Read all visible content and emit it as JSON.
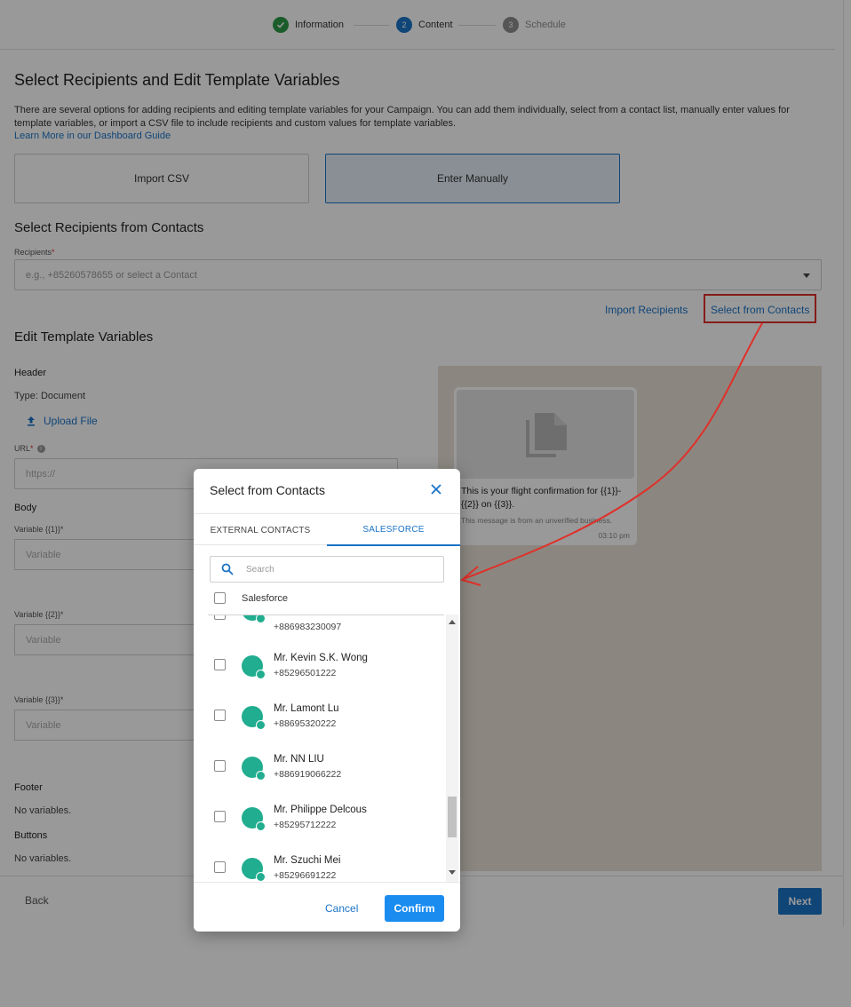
{
  "stepper": {
    "steps": [
      {
        "num": "✓",
        "label": "Information",
        "state": "done"
      },
      {
        "num": "2",
        "label": "Content",
        "state": "active"
      },
      {
        "num": "3",
        "label": "Schedule",
        "state": "todo"
      }
    ]
  },
  "page": {
    "title": "Select Recipients and Edit Template Variables",
    "intro": "There are several options for adding recipients and editing template variables for your Campaign. You can add them individually, select from a contact list, manually enter values for template variables, or import a CSV file to include recipients and custom values for template variables.",
    "intro_link": "Learn More in our Dashboard Guide",
    "option_import_csv": "Import CSV",
    "option_enter_manually": "Enter Manually",
    "recipients_section_title": "Select Recipients from Contacts",
    "recipients_label": "Recipients",
    "recipients_required": "*",
    "recipients_placeholder": "e.g., +85260578655 or select a Contact",
    "import_recipients": "Import Recipients",
    "select_from_contacts": "Select from Contacts",
    "edit_vars_title": "Edit Template Variables",
    "header_label": "Header",
    "header_type": "Type: Document",
    "upload_file": "Upload File",
    "url_label": "URL",
    "url_required": "*",
    "url_info": "i",
    "url_placeholder": "https://",
    "body_label": "Body",
    "var1_label": "Variable {{1}}*",
    "var2_label": "Variable {{2}}*",
    "var3_label": "Variable {{3}}*",
    "var_placeholder": "Variable",
    "footer_label": "Footer",
    "footer_none": "No variables.",
    "buttons_label": "Buttons",
    "buttons_none": "No variables.",
    "back": "Back",
    "next": "Next"
  },
  "preview": {
    "message": "This is your flight confirmation for {{1}}-{{2}} on {{3}}.",
    "note": "This message is from an unverified business.",
    "time": "03:10 pm"
  },
  "modal": {
    "title": "Select from Contacts",
    "tabs": [
      "EXTERNAL CONTACTS",
      "SALESFORCE"
    ],
    "active_tab": "SALESFORCE",
    "search_placeholder": "Search",
    "group_label": "Salesforce",
    "contacts": [
      {
        "name": "",
        "phone": "+886983230097"
      },
      {
        "name": "Mr. Kevin S.K. Wong",
        "phone": "+85296501222"
      },
      {
        "name": "Mr. Lamont Lu",
        "phone": "+88695320222"
      },
      {
        "name": "Mr. NN LIU",
        "phone": "+886919066222"
      },
      {
        "name": "Mr. Philippe Delcous",
        "phone": "+85295712222"
      },
      {
        "name": "Mr. Szuchi Mei",
        "phone": "+85296691222"
      }
    ],
    "cancel": "Cancel",
    "confirm": "Confirm"
  },
  "colors": {
    "accent": "#1a73c7",
    "confirm": "#1a8cf0",
    "avatar": "#21ad8f",
    "annotation": "#e0302a",
    "done": "#2e9b47"
  }
}
